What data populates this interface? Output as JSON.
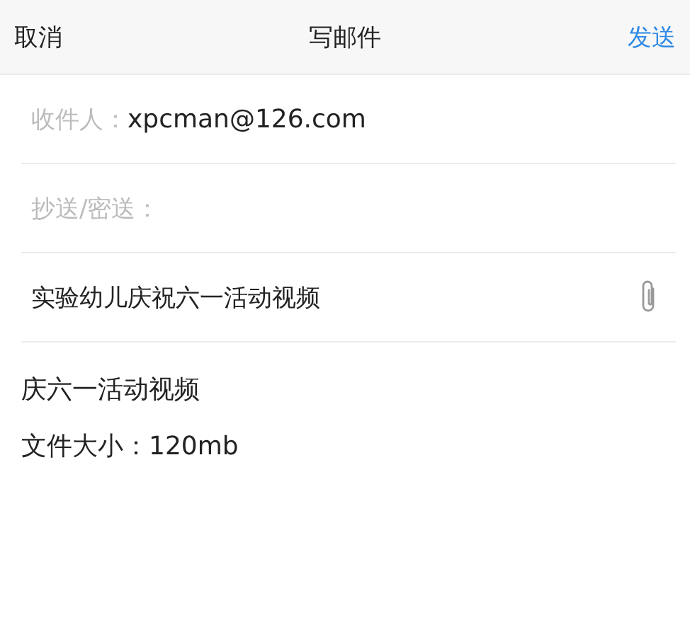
{
  "header": {
    "cancel": "取消",
    "title": "写邮件",
    "send": "发送"
  },
  "fields": [
    {
      "label": "收件人：",
      "value": "xpcman@126.com"
    },
    {
      "label": "抄送/密送："
    }
  ],
  "subject": {
    "value": "实验幼儿庆祝六一活动视频"
  },
  "body": [
    "庆六一活动视频",
    "文件大小：120mb"
  ]
}
